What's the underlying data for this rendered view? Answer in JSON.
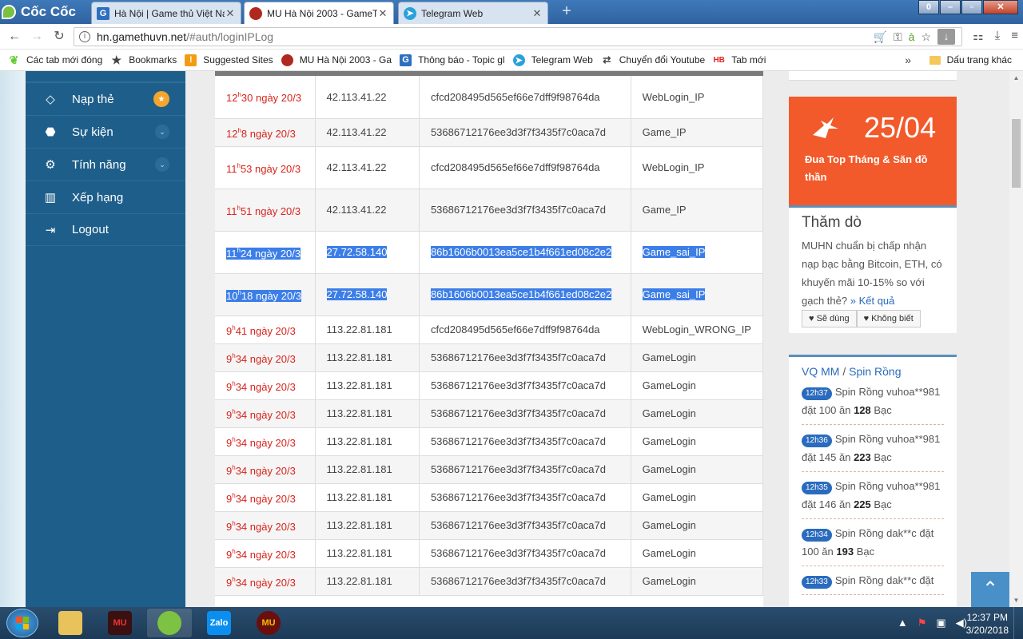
{
  "browser": {
    "brand": "Cốc Cốc",
    "tabs": [
      {
        "title": "Hà Nội | Game thủ Việt Nam",
        "icon": "G",
        "color": "#2d6fbf"
      },
      {
        "title": "MU Hà Nội 2003 - GameThủ",
        "icon": "mu-icon",
        "color": "#b0281e",
        "active": true
      },
      {
        "title": "Telegram Web",
        "icon": "telegram-icon",
        "color": "#2aa1da"
      }
    ],
    "url_host": "hn.gamethuvn.net",
    "url_path": "/#auth/loginIPLog",
    "bookmarks": [
      {
        "label": "Các tab mới đóng",
        "icon": "coccoc-icon"
      },
      {
        "label": "Bookmarks",
        "icon": "star-icon"
      },
      {
        "label": "Suggested Sites",
        "icon": "suggested-icon"
      },
      {
        "label": "MU Hà Nội 2003 - Ga",
        "icon": "mu-icon"
      },
      {
        "label": "Thông báo - Topic gl",
        "icon": "G"
      },
      {
        "label": "Telegram Web",
        "icon": "telegram-icon"
      },
      {
        "label": "Chuyển đổi Youtube",
        "icon": "youtube-convert-icon"
      },
      {
        "label": "Tab mới",
        "icon": "HB"
      }
    ],
    "bookmarks_other": "Dấu trang khác",
    "bookmarks_more": "»"
  },
  "sidebar": {
    "items": [
      {
        "label": "Nạp thẻ",
        "icon": "diamond-icon",
        "badge": "star"
      },
      {
        "label": "Sự kiện",
        "icon": "android-icon",
        "badge": "chevron"
      },
      {
        "label": "Tính năng",
        "icon": "gears-icon",
        "badge": "chevron"
      },
      {
        "label": "Xếp hạng",
        "icon": "bar-chart-icon",
        "badge": ""
      },
      {
        "label": "Logout",
        "icon": "logout-icon",
        "badge": ""
      }
    ]
  },
  "log_table": {
    "rows": [
      {
        "hour": "12",
        "rest": "30 ngày 20/3",
        "ip": "42.113.41.22",
        "hash": "cfcd208495d565ef66e7dff9f98764da",
        "type": "WebLogin_IP",
        "selected": false,
        "tall": true
      },
      {
        "hour": "12",
        "rest": "8 ngày 20/3",
        "ip": "42.113.41.22",
        "hash": "53686712176ee3d3f7f3435f7c0aca7d",
        "type": "Game_IP",
        "selected": false,
        "tall": false
      },
      {
        "hour": "11",
        "rest": "53 ngày 20/3",
        "ip": "42.113.41.22",
        "hash": "cfcd208495d565ef66e7dff9f98764da",
        "type": "WebLogin_IP",
        "selected": false,
        "tall": true
      },
      {
        "hour": "11",
        "rest": "51 ngày 20/3",
        "ip": "42.113.41.22",
        "hash": "53686712176ee3d3f7f3435f7c0aca7d",
        "type": "Game_IP",
        "selected": false,
        "tall": true
      },
      {
        "hour": "11",
        "rest": "24 ngày 20/3",
        "ip": "27.72.58.140",
        "hash": "86b1606b0013ea5ce1b4f661ed08c2e2",
        "type": "Game_sai_IP",
        "selected": true,
        "tall": true
      },
      {
        "hour": "10",
        "rest": "18 ngày 20/3",
        "ip": "27.72.58.140",
        "hash": "86b1606b0013ea5ce1b4f661ed08c2e2",
        "type": "Game_sai_IP",
        "selected": true,
        "tall": true
      },
      {
        "hour": "9",
        "rest": "41 ngày 20/3",
        "ip": "113.22.81.181",
        "hash": "cfcd208495d565ef66e7dff9f98764da",
        "type": "WebLogin_WRONG_IP",
        "selected": false,
        "tall": false
      },
      {
        "hour": "9",
        "rest": "34 ngày 20/3",
        "ip": "113.22.81.181",
        "hash": "53686712176ee3d3f7f3435f7c0aca7d",
        "type": "GameLogin",
        "selected": false,
        "tall": false
      },
      {
        "hour": "9",
        "rest": "34 ngày 20/3",
        "ip": "113.22.81.181",
        "hash": "53686712176ee3d3f7f3435f7c0aca7d",
        "type": "GameLogin",
        "selected": false,
        "tall": false
      },
      {
        "hour": "9",
        "rest": "34 ngày 20/3",
        "ip": "113.22.81.181",
        "hash": "53686712176ee3d3f7f3435f7c0aca7d",
        "type": "GameLogin",
        "selected": false,
        "tall": false
      },
      {
        "hour": "9",
        "rest": "34 ngày 20/3",
        "ip": "113.22.81.181",
        "hash": "53686712176ee3d3f7f3435f7c0aca7d",
        "type": "GameLogin",
        "selected": false,
        "tall": false
      },
      {
        "hour": "9",
        "rest": "34 ngày 20/3",
        "ip": "113.22.81.181",
        "hash": "53686712176ee3d3f7f3435f7c0aca7d",
        "type": "GameLogin",
        "selected": false,
        "tall": false
      },
      {
        "hour": "9",
        "rest": "34 ngày 20/3",
        "ip": "113.22.81.181",
        "hash": "53686712176ee3d3f7f3435f7c0aca7d",
        "type": "GameLogin",
        "selected": false,
        "tall": false
      },
      {
        "hour": "9",
        "rest": "34 ngày 20/3",
        "ip": "113.22.81.181",
        "hash": "53686712176ee3d3f7f3435f7c0aca7d",
        "type": "GameLogin",
        "selected": false,
        "tall": false
      },
      {
        "hour": "9",
        "rest": "34 ngày 20/3",
        "ip": "113.22.81.181",
        "hash": "53686712176ee3d3f7f3435f7c0aca7d",
        "type": "GameLogin",
        "selected": false,
        "tall": false
      },
      {
        "hour": "9",
        "rest": "34 ngày 20/3",
        "ip": "113.22.81.181",
        "hash": "53686712176ee3d3f7f3435f7c0aca7d",
        "type": "GameLogin",
        "selected": false,
        "tall": false
      }
    ]
  },
  "event": {
    "date": "25/04",
    "desc": "Đua Top Tháng & Săn đồ thần"
  },
  "poll": {
    "title": "Thăm dò",
    "question": "MUHN chuẩn bị chấp nhận nạp bạc bằng Bitcoin, ETH, có khuyến mãi 10-15% so với gạch thẻ?",
    "result_link": "» Kết quả",
    "btn_yes": "Sẽ dùng",
    "btn_no": "Không biết"
  },
  "spin": {
    "link1": "VQ MM",
    "sep": "/",
    "link2": "Spin Rồng",
    "entries": [
      {
        "time": "12h37",
        "text": "Spin Rồng vuhoa**981 đặt 100 ăn ",
        "win": "128",
        "unit": " Bạc"
      },
      {
        "time": "12h36",
        "text": "Spin Rồng vuhoa**981 đặt 145 ăn ",
        "win": "223",
        "unit": " Bạc"
      },
      {
        "time": "12h35",
        "text": "Spin Rồng vuhoa**981 đặt 146 ăn ",
        "win": "225",
        "unit": " Bạc"
      },
      {
        "time": "12h34",
        "text": "Spin Rồng dak**c đặt 100 ăn ",
        "win": "193",
        "unit": " Bạc"
      },
      {
        "time": "12h33",
        "text": "Spin Rồng dak**c đặt",
        "win": "",
        "unit": ""
      }
    ]
  },
  "taskbar": {
    "time": "12:37 PM",
    "date": "3/20/2018",
    "apps": [
      "file-explorer-icon",
      "mu-game-icon",
      "coccoc-icon",
      "zalo-icon",
      "mu-launcher-icon"
    ],
    "zalo_label": "Zalo",
    "mu_label": "MU"
  }
}
